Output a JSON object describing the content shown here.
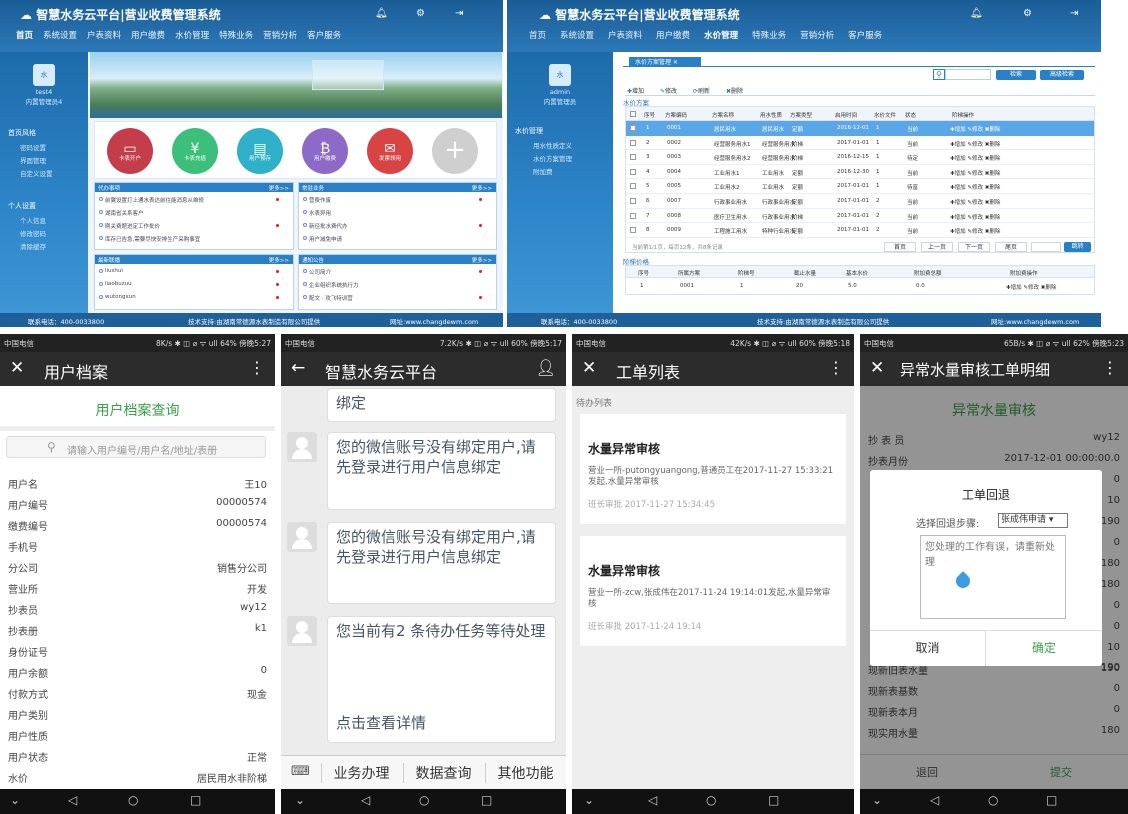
{
  "desktop1": {
    "brand": "智慧水务云平台|营业收费管理系统",
    "nav": [
      "首页",
      "系统设置",
      "户表资料",
      "用户缴费",
      "水价管理",
      "特殊业务",
      "营销分析",
      "客户服务"
    ],
    "user": "test4",
    "role": "内置管理员4",
    "side_groups": [
      {
        "title": "首页风格",
        "items": [
          "密码设置",
          "界面管理",
          "自定义设置"
        ]
      },
      {
        "title": "个人设置",
        "items": [
          "个人信息",
          "修改密码",
          "清除缓存"
        ]
      }
    ],
    "quick": [
      "卡表开户",
      "卡表充值",
      "用户预存",
      "用户缴费",
      "发票领用"
    ],
    "boxes": [
      {
        "title": "代办事项",
        "more": "更多>>",
        "items": [
          "前翼设置打上通水表达前往能消息从维修",
          "湖南省关系客户",
          "刚关费题进定工作批价",
          "库存已告急,需要尽快安排生产采购事宜"
        ]
      },
      {
        "title": "常驻业务",
        "more": "更多>>",
        "items": [
          "营费作废",
          "水表异用",
          "新径批水费代办",
          "用户减免申请"
        ]
      },
      {
        "title": "最新联播",
        "more": "更多>>",
        "items": [
          "liushui",
          "liaobuzuu",
          "wutongxun"
        ]
      },
      {
        "title": "通知公告",
        "more": "更多>>",
        "items": [
          "公司简介",
          "企业组织系统执行力",
          "配文 · 攻飞特训营"
        ]
      }
    ],
    "footer_phone": "联系电话：400-0033800",
    "footer_tech": "技术支持:由湖南常德源水表制造有限公司提供",
    "footer_site": "网址:www.changdewm.com"
  },
  "desktop2": {
    "brand": "智慧水务云平台|营业收费管理系统",
    "nav": [
      "首页",
      "系统设置",
      "户表资料",
      "用户缴费",
      "水价管理",
      "特殊业务",
      "营销分析",
      "客户服务"
    ],
    "user": "admin",
    "role": "内置管理员",
    "side_title": "水价管理",
    "side_items": [
      "用水性质定义",
      "水价方案管理",
      "附加费"
    ],
    "tab": "水价方案管理",
    "search_btn": "检索",
    "adv_btn": "高级检索",
    "toolbar": [
      "增加",
      "修改",
      "刷新",
      "删除"
    ],
    "section1": "水价方案",
    "cols": [
      "序号",
      "方案编码",
      "方案名称",
      "用水性质",
      "方案类型",
      "启用时间",
      "水价文件",
      "状态",
      "阶梯操作"
    ],
    "rows": [
      [
        "1",
        "0001",
        "居民用水",
        "居民用水",
        "定额",
        "2016-12-01",
        "1",
        "当前"
      ],
      [
        "2",
        "0002",
        "经营服务用水1",
        "经营服务用水",
        "阶梯",
        "2017-01-01",
        "1",
        "当前"
      ],
      [
        "3",
        "0003",
        "经营服务用水2",
        "经营服务用水",
        "阶梯",
        "2016-12-15",
        "1",
        "待定"
      ],
      [
        "4",
        "0004",
        "工业用水1",
        "工业用水",
        "定额",
        "2016-12-30",
        "1",
        "当前"
      ],
      [
        "5",
        "0005",
        "工业用水2",
        "工业用水",
        "定额",
        "2017-01-01",
        "1",
        "待富"
      ],
      [
        "6",
        "0007",
        "行政事业用水",
        "行政事业用水",
        "定额",
        "2017-01-01",
        "2",
        "当前"
      ],
      [
        "7",
        "0008",
        "医疗卫生用水",
        "行政事业用水",
        "阶梯",
        "2017-01-01",
        "2",
        "当前"
      ],
      [
        "8",
        "0009",
        "工程施工用水",
        "特种行业用水",
        "定额",
        "2017-01-01",
        "2",
        "当前"
      ]
    ],
    "row_ops": "✚增加 ✎修改 ✖删除",
    "pager_info": "当前第1/1页，每页12条，共8条记录",
    "pager": [
      "首页",
      "上一页",
      "下一页",
      "尾页"
    ],
    "jump": "跳转",
    "section2": "阶梯价格",
    "cols2": [
      "序号",
      "所属方案",
      "阶梯号",
      "截止水量",
      "基本水价",
      "附加费总额",
      "附加费操作"
    ],
    "row2": [
      "1",
      "0001",
      "1",
      "20",
      "5.0",
      "0.0"
    ],
    "footer_phone": "联系电话：400-0033800",
    "footer_tech": "技术支持:由湖南常德源水表制造有限公司提供",
    "footer_site": "网址:www.changdewm.com"
  },
  "phone1": {
    "status_left": "中国电信",
    "status_right": "8K/s ✱ ◫ ⌀ ᯤ ull 64% 傍晚5:27",
    "title": "用户档案",
    "heading": "用户档案查询",
    "search_placeholder": "请输入用户编号/用户名/地址/表册",
    "fields": [
      [
        "用户名",
        "王10"
      ],
      [
        "用户编号",
        "00000574"
      ],
      [
        "缴费编号",
        "00000574"
      ],
      [
        "手机号",
        ""
      ],
      [
        "分公司",
        "销售分公司"
      ],
      [
        "营业所",
        "开发"
      ],
      [
        "抄表员",
        "wy12"
      ],
      [
        "抄表册",
        "k1"
      ],
      [
        "身份证号",
        ""
      ],
      [
        "用户余额",
        "0"
      ],
      [
        "付款方式",
        "现金"
      ],
      [
        "用户类别",
        ""
      ],
      [
        "用户性质",
        ""
      ],
      [
        "用户状态",
        "正常"
      ],
      [
        "水价",
        "居民用水非阶梯"
      ]
    ]
  },
  "phone2": {
    "status_left": "中国电信",
    "status_right": "7.2K/s ✱ ◫ ⌀ ᯤ ull 60% 傍晚5:17",
    "title": "智慧水务云平台",
    "msg0": "绑定",
    "msg1": "您的微信账号没有绑定用户,请先登录进行用户信息绑定",
    "msg2": "您的微信账号没有绑定用户,请先登录进行用户信息绑定",
    "msg3": "您当前有2 条待办任务等待处理",
    "link": "点击查看详情",
    "menu": [
      "业务办理",
      "数据查询",
      "其他功能"
    ]
  },
  "phone3": {
    "status_left": "中国电信",
    "status_right": "42K/s ✱ ◫ ⌀ ᯤ ull 60% 傍晚5:18",
    "title": "工单列表",
    "sub": "待办列表",
    "cards": [
      {
        "title": "水量异常审核",
        "body": "营业一所-putongyuangong,普通员工在2017-11-27 15:33:21发起,水量异常审核",
        "meta": "班长审批  2017-11-27 15:34:45"
      },
      {
        "title": "水量异常审核",
        "body": "营业一所-zcw,张成伟在2017-11-24 19:14:01发起,水量异常审核",
        "meta": "班长审批  2017-11-24 19:14"
      }
    ]
  },
  "phone4": {
    "status_left": "中国电信",
    "status_right": "65B/s ✱ ◫ ⌀ ᯤ ull 62% 傍晚5:23",
    "title": "异常水量审核工单明细",
    "heading": "异常水量审核",
    "rows": [
      [
        "抄 表 员",
        "wy12"
      ],
      [
        "抄表月份",
        "2017-12-01 00:00:00.0"
      ]
    ],
    "rows_b": [
      [
        "现新旧表水量",
        "190"
      ],
      [
        "现新表基数",
        "0"
      ],
      [
        "现新表本月",
        "0"
      ],
      [
        "现实用水量",
        "180"
      ]
    ],
    "bg_values": [
      "0",
      "10",
      "190",
      "0",
      "180",
      "180",
      "0",
      "0",
      "10",
      "190"
    ],
    "dialog": {
      "title": "工单回退",
      "label": "选择回退步骤:",
      "option": "张成伟申请",
      "text": "您处理的工作有误，请重新处理",
      "cancel": "取消",
      "ok": "确定"
    },
    "back": "退回",
    "submit": "提交"
  }
}
